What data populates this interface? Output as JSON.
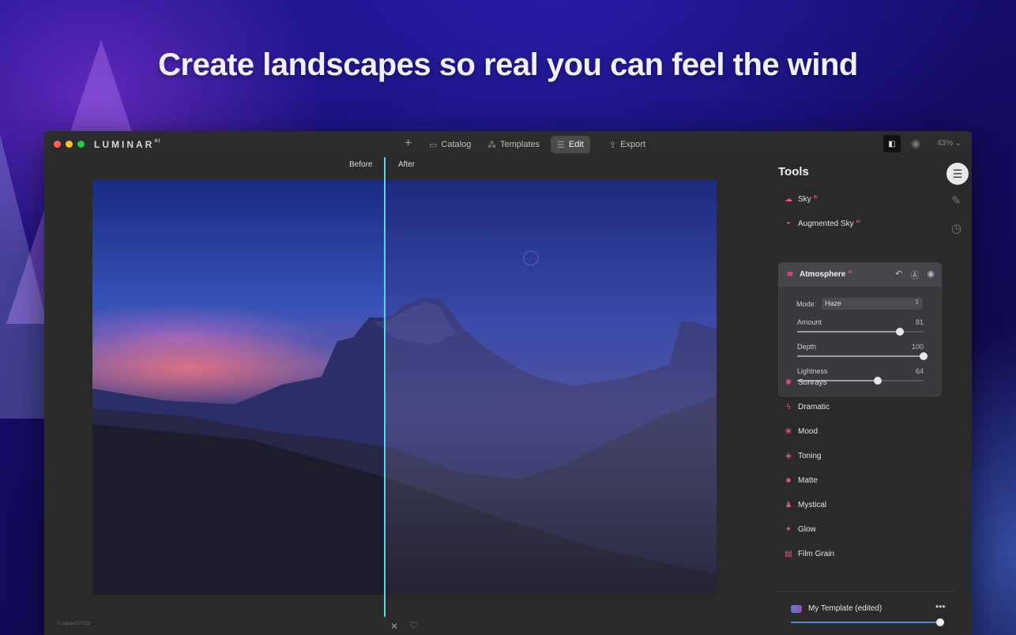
{
  "headline": "Create landscapes so real  you can feel the wind",
  "app": {
    "logo": "LUMINAR",
    "logo_suffix": "AI",
    "nav": {
      "plus": "+",
      "catalog": "Catalog",
      "templates": "Templates",
      "edit": "Edit",
      "export": "Export"
    },
    "zoom": "43% ⌄"
  },
  "canvas": {
    "before_label": "Before",
    "after_label": "After",
    "credit": "© jaguar107222"
  },
  "tools": {
    "title": "Tools",
    "ai_badge": "AI",
    "items_top": [
      {
        "label": "Sky",
        "icon": "cloud-icon",
        "ai": true
      },
      {
        "label": "Augmented Sky",
        "icon": "augmented-sky-icon",
        "ai": true
      }
    ],
    "atmosphere": {
      "label": "Atmosphere",
      "mode_label": "Mode:",
      "mode_value": "Haze",
      "sliders": [
        {
          "name": "Amount",
          "value": "81",
          "fraction": 0.81
        },
        {
          "name": "Depth",
          "value": "100",
          "fraction": 1.0
        },
        {
          "name": "Lightness",
          "value": "64",
          "fraction": 0.64
        }
      ]
    },
    "items": [
      {
        "label": "Sunrays",
        "icon": "sunrays-icon"
      },
      {
        "label": "Dramatic",
        "icon": "dramatic-icon"
      },
      {
        "label": "Mood",
        "icon": "mood-icon"
      },
      {
        "label": "Toning",
        "icon": "toning-icon"
      },
      {
        "label": "Matte",
        "icon": "matte-icon"
      },
      {
        "label": "Mystical",
        "icon": "mystical-icon"
      },
      {
        "label": "Glow",
        "icon": "glow-icon"
      },
      {
        "label": "Film Grain",
        "icon": "film-grain-icon"
      }
    ]
  },
  "template": {
    "name": "My Template (edited)",
    "more": "•••",
    "amount_fraction": 0.99
  },
  "colors": {
    "accent_pink": "#e0567c",
    "split_line": "#58d6f0",
    "template_slider": "#4c86e8"
  }
}
